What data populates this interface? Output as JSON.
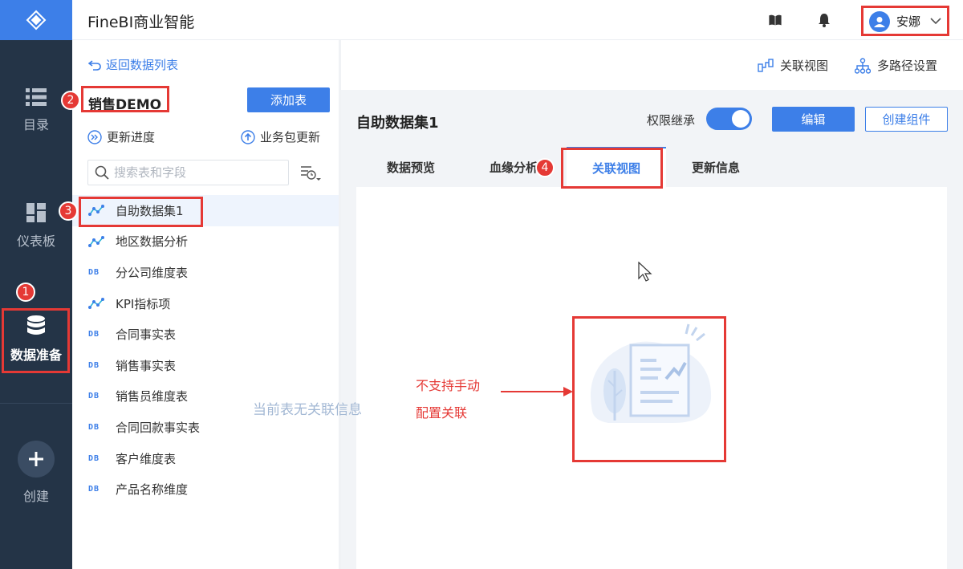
{
  "app": {
    "title": "FineBI商业智能"
  },
  "user": {
    "name": "安娜"
  },
  "rail": {
    "items": [
      {
        "label": "目录",
        "icon": "list-icon"
      },
      {
        "label": "仪表板",
        "icon": "dashboard-icon"
      },
      {
        "label": "数据准备",
        "icon": "database-icon"
      },
      {
        "label": "创建",
        "icon": "plus-icon"
      }
    ]
  },
  "midpanel": {
    "back_label": "返回数据列表",
    "package_name": "销售DEMO",
    "add_table_label": "添加表",
    "update_progress_label": "更新进度",
    "package_update_label": "业务包更新",
    "search_placeholder": "搜索表和字段",
    "tables": [
      {
        "name": "自助数据集1",
        "type": "self-service"
      },
      {
        "name": "地区数据分析",
        "type": "self-service"
      },
      {
        "name": "分公司维度表",
        "type": "db"
      },
      {
        "name": "KPI指标项",
        "type": "self-service"
      },
      {
        "name": "合同事实表",
        "type": "db"
      },
      {
        "name": "销售事实表",
        "type": "db"
      },
      {
        "name": "销售员维度表",
        "type": "db"
      },
      {
        "name": "合同回款事实表",
        "type": "db"
      },
      {
        "name": "客户维度表",
        "type": "db"
      },
      {
        "name": "产品名称维度",
        "type": "db"
      }
    ],
    "db_icon_text": "DB"
  },
  "right": {
    "relation_view_link": "关联视图",
    "multipath_link": "多路径设置",
    "dataset_title": "自助数据集1",
    "permission_label": "权限继承",
    "permission_on": true,
    "edit_label": "编辑",
    "create_component_label": "创建组件",
    "tabs": [
      {
        "label": "数据预览"
      },
      {
        "label": "血缘分析"
      },
      {
        "label": "关联视图",
        "active": true
      },
      {
        "label": "更新信息"
      }
    ],
    "empty_text": "当前表无关联信息"
  },
  "annotations": {
    "badges": [
      "1",
      "2",
      "3",
      "4"
    ],
    "note_line1": "不支持手动",
    "note_line2": "配置关联"
  },
  "colors": {
    "accent": "#3d7fe8",
    "rail_bg": "#243447",
    "annotation": "#e53935"
  }
}
